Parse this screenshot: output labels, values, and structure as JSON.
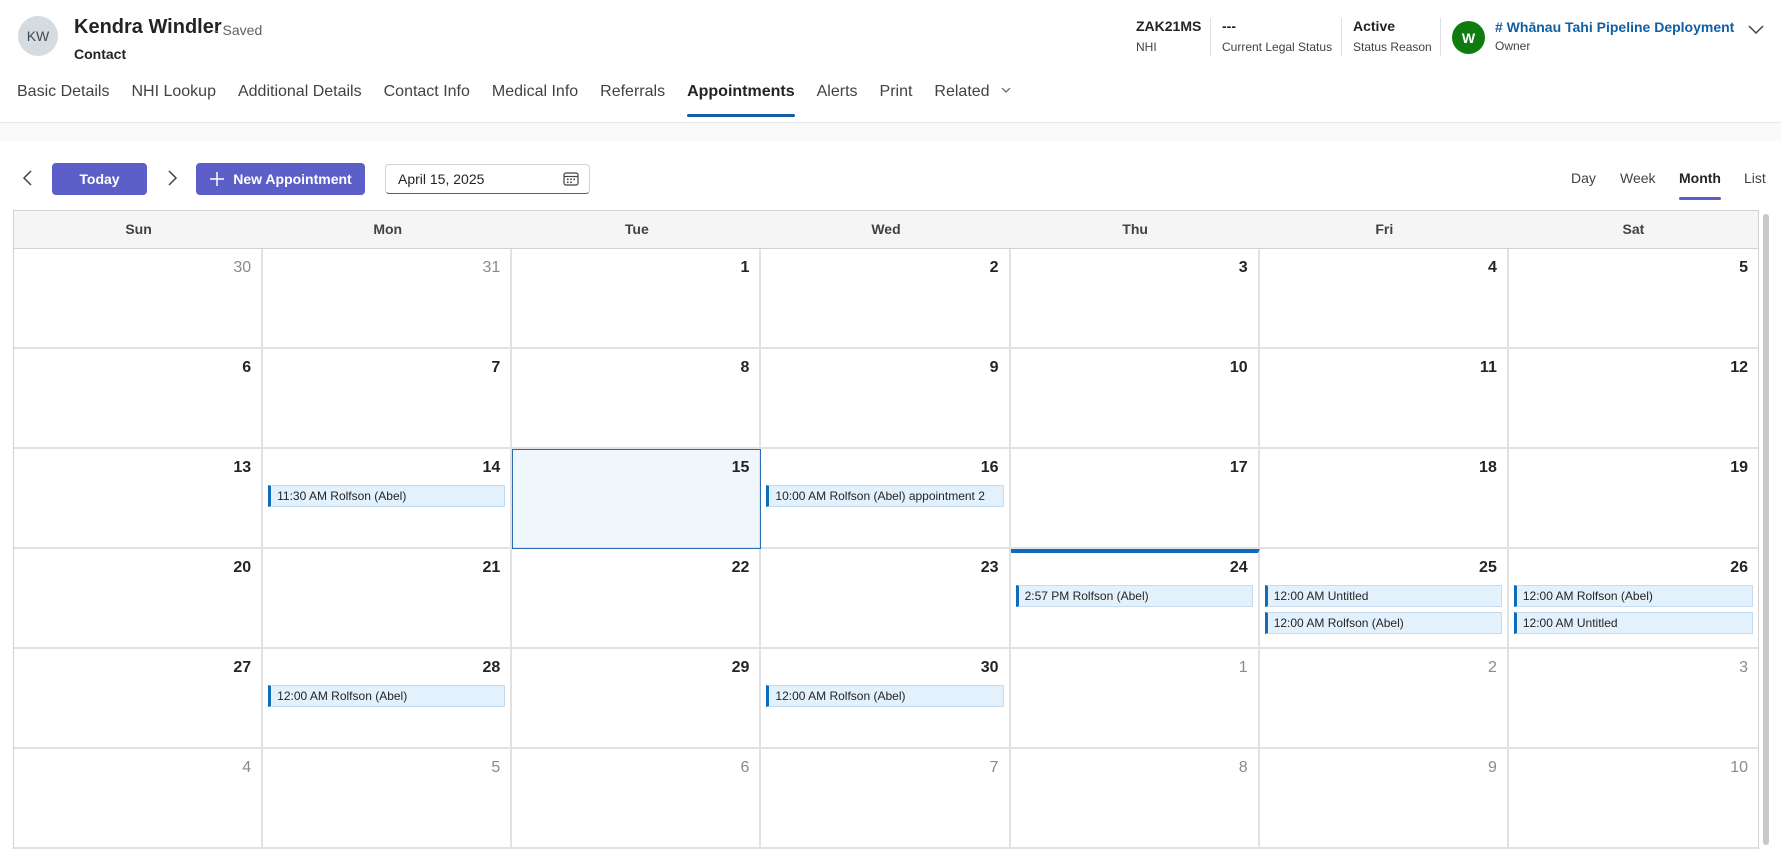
{
  "record": {
    "initials": "KW",
    "name": "Kendra Windler",
    "save_status": "- Saved",
    "entity": "Contact"
  },
  "header_fields": [
    {
      "value": "ZAK21MS",
      "label": "NHI"
    },
    {
      "value": "---",
      "label": "Current Legal Status"
    },
    {
      "value": "Active",
      "label": "Status Reason"
    }
  ],
  "owner": {
    "initial": "W",
    "name": "# Whānau Tahi Pipeline Deployment",
    "label": "Owner"
  },
  "tabs": [
    {
      "label": "Basic Details"
    },
    {
      "label": "NHI Lookup"
    },
    {
      "label": "Additional Details"
    },
    {
      "label": "Contact Info"
    },
    {
      "label": "Medical Info"
    },
    {
      "label": "Referrals"
    },
    {
      "label": "Appointments",
      "active": true
    },
    {
      "label": "Alerts"
    },
    {
      "label": "Print"
    },
    {
      "label": "Related",
      "dropdown": true
    }
  ],
  "toolbar": {
    "today_label": "Today",
    "new_label": "New Appointment",
    "date_value": "April 15, 2025",
    "views": [
      "Day",
      "Week",
      "Month",
      "List"
    ],
    "active_view": "Month"
  },
  "calendar": {
    "weekdays": [
      "Sun",
      "Mon",
      "Tue",
      "Wed",
      "Thu",
      "Fri",
      "Sat"
    ],
    "days": [
      {
        "d": "30",
        "other": true
      },
      {
        "d": "31",
        "other": true
      },
      {
        "d": "1"
      },
      {
        "d": "2"
      },
      {
        "d": "3"
      },
      {
        "d": "4"
      },
      {
        "d": "5"
      },
      {
        "d": "6"
      },
      {
        "d": "7"
      },
      {
        "d": "8"
      },
      {
        "d": "9"
      },
      {
        "d": "10"
      },
      {
        "d": "11"
      },
      {
        "d": "12"
      },
      {
        "d": "13"
      },
      {
        "d": "14",
        "events": [
          "11:30 AM Rolfson (Abel)"
        ]
      },
      {
        "d": "15",
        "selected": true
      },
      {
        "d": "16",
        "events": [
          "10:00 AM Rolfson (Abel) appointment 2"
        ]
      },
      {
        "d": "17"
      },
      {
        "d": "18"
      },
      {
        "d": "19"
      },
      {
        "d": "20"
      },
      {
        "d": "21"
      },
      {
        "d": "22"
      },
      {
        "d": "23"
      },
      {
        "d": "24",
        "today": true,
        "events": [
          "2:57 PM Rolfson (Abel)"
        ]
      },
      {
        "d": "25",
        "events": [
          "12:00 AM Untitled",
          "12:00 AM Rolfson (Abel)"
        ]
      },
      {
        "d": "26",
        "events": [
          "12:00 AM Rolfson (Abel)",
          "12:00 AM Untitled"
        ]
      },
      {
        "d": "27"
      },
      {
        "d": "28",
        "events": [
          "12:00 AM Rolfson (Abel)"
        ]
      },
      {
        "d": "29"
      },
      {
        "d": "30",
        "events": [
          "12:00 AM Rolfson (Abel)"
        ]
      },
      {
        "d": "1",
        "other": true
      },
      {
        "d": "2",
        "other": true
      },
      {
        "d": "3",
        "other": true
      },
      {
        "d": "4",
        "other": true
      },
      {
        "d": "5",
        "other": true
      },
      {
        "d": "6",
        "other": true
      },
      {
        "d": "7",
        "other": true
      },
      {
        "d": "8",
        "other": true
      },
      {
        "d": "9",
        "other": true
      },
      {
        "d": "10",
        "other": true
      }
    ]
  },
  "colors": {
    "accent": "#5b5fc7",
    "event_bar": "#0f6cbd",
    "owner_avatar": "#107c10",
    "link": "#115ea3"
  }
}
